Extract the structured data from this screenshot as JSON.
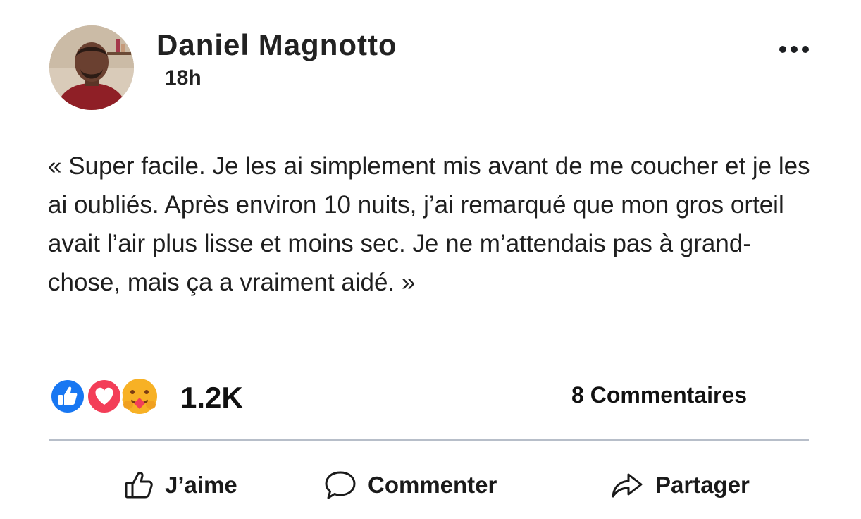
{
  "post": {
    "author_name": "Daniel Magnotto",
    "time": "18h",
    "text": "« Super facile. Je les ai simplement mis avant de me coucher et je les ai oubliés. Après environ 10 nuits, j’ai remarqué que mon gros orteil avait l’air plus lisse et moins sec. Je ne m’attendais pas à grand-chose, mais ça a vraiment aidé. »"
  },
  "reactions": {
    "icons": [
      "like-icon",
      "love-icon",
      "care-icon"
    ],
    "count": "1.2K",
    "comments": "8 Commentaires"
  },
  "actions": {
    "like_label": "J’aime",
    "comment_label": "Commenter",
    "share_label": "Partager"
  },
  "colors": {
    "like_blue": "#1877f2",
    "love_red": "#f33e58",
    "care_yellow": "#f7b125",
    "divider": "#b7bec9"
  }
}
